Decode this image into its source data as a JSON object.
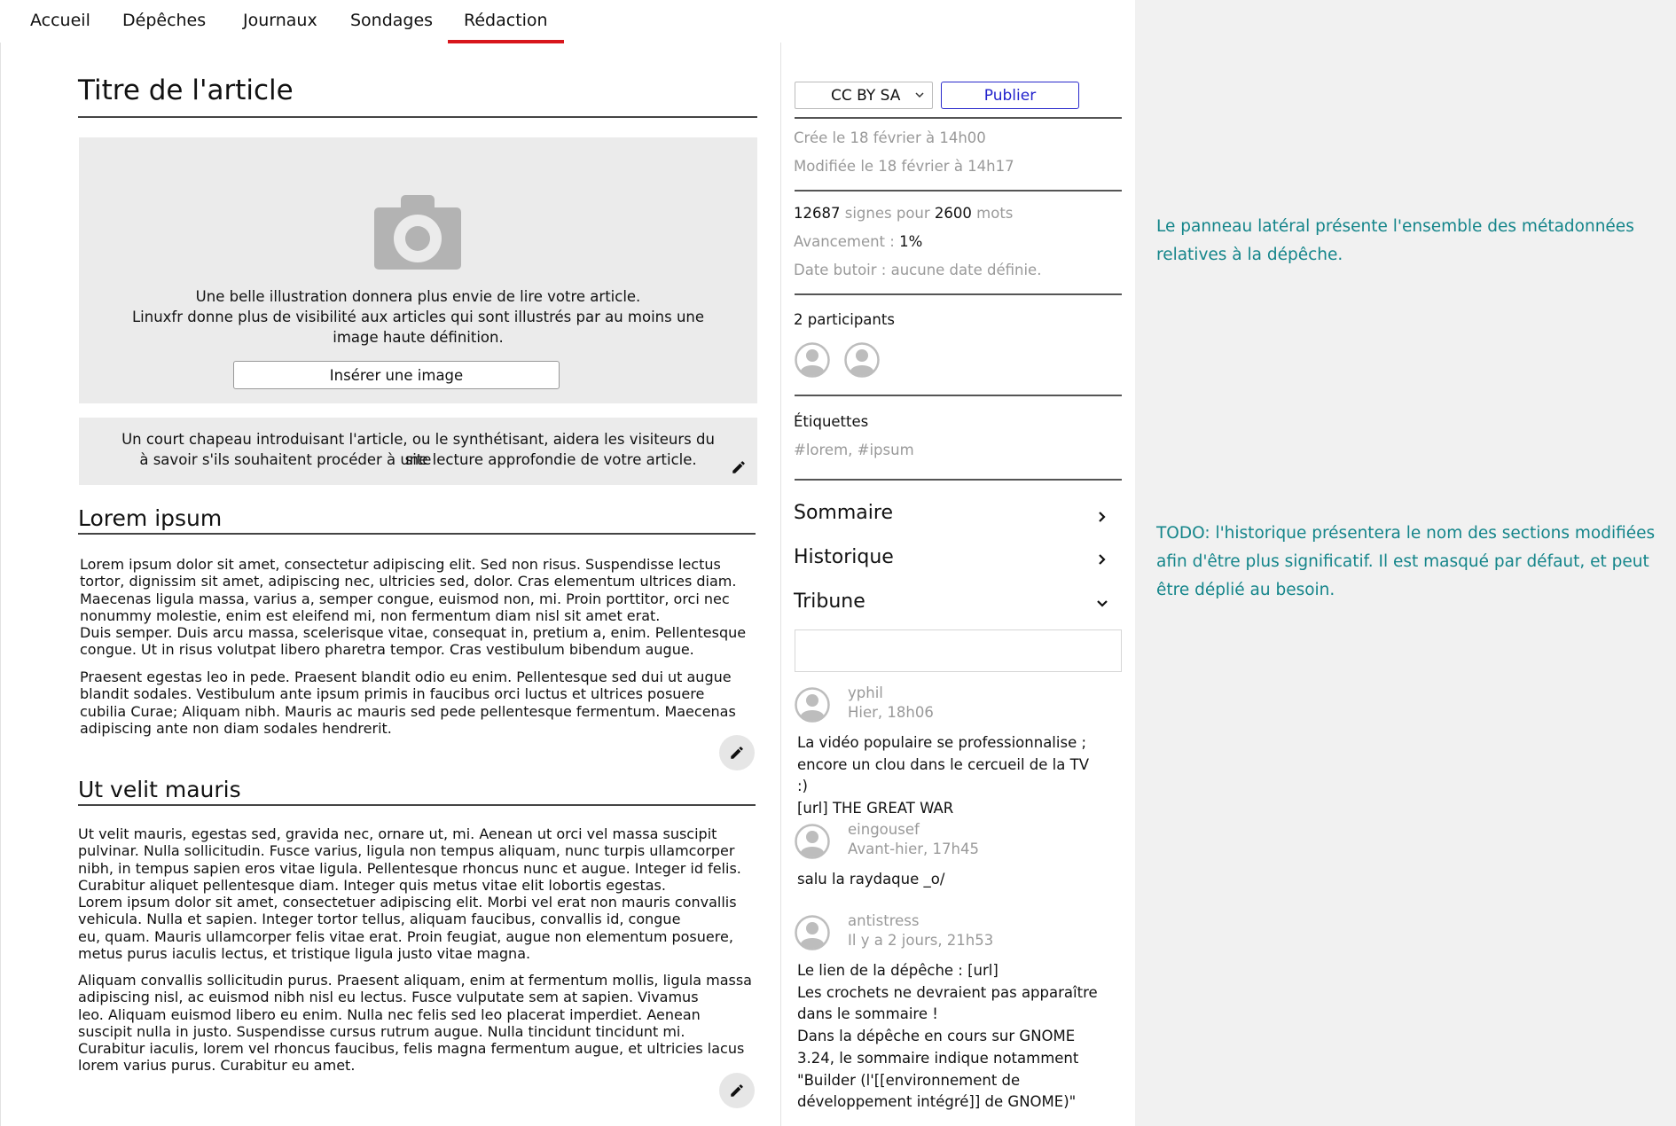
{
  "nav": {
    "items": [
      {
        "label": "Accueil"
      },
      {
        "label": "Dépêches"
      },
      {
        "label": "Journaux"
      },
      {
        "label": "Sondages"
      },
      {
        "label": "Rédaction"
      }
    ],
    "active": "Rédaction",
    "active_color": "#d8161c"
  },
  "article": {
    "title": "Titre de l'article",
    "illustration": {
      "icon": "camera-icon",
      "text_1": "Une belle illustration donnera plus envie de lire votre article.",
      "text_2": "Linuxfr donne plus de visibilité aux articles qui sont illustrés par au moins une",
      "text_3": "image haute définition.",
      "insert_button": "Insérer une image"
    },
    "chapeau": {
      "line_1": "Un court chapeau introduisant l'article, ou le synthétisant, aidera les visiteurs du site",
      "line_2": "à savoir s'ils souhaitent procéder à une lecture approfondie de votre article."
    },
    "sections": [
      {
        "title": "Lorem ipsum",
        "paragraphs": [
          [
            "Lorem ipsum dolor sit amet, consectetur adipiscing elit. Sed non risus. Suspendisse lectus",
            "tortor, dignissim sit amet, adipiscing nec, ultricies sed, dolor. Cras elementum ultrices diam.",
            "Maecenas ligula massa, varius a, semper congue, euismod non, mi. Proin porttitor, orci nec",
            "nonummy molestie, enim est eleifend mi, non fermentum diam nisl sit amet erat.",
            "Duis semper. Duis arcu massa, scelerisque vitae, consequat in, pretium a, enim. Pellentesque",
            "congue. Ut in risus volutpat libero pharetra tempor. Cras vestibulum bibendum augue."
          ],
          [
            "Praesent egestas leo in pede. Praesent blandit odio eu enim. Pellentesque sed dui ut augue",
            "blandit sodales. Vestibulum ante ipsum primis in faucibus orci luctus et ultrices posuere",
            "cubilia Curae; Aliquam nibh. Mauris ac mauris sed pede pellentesque fermentum. Maecenas",
            "adipiscing ante non diam sodales hendrerit."
          ]
        ]
      },
      {
        "title": "Ut velit mauris",
        "paragraphs": [
          [
            "Ut velit mauris, egestas sed, gravida nec, ornare ut, mi. Aenean ut orci vel massa suscipit",
            "pulvinar. Nulla sollicitudin. Fusce varius, ligula non tempus aliquam, nunc turpis ullamcorper",
            "nibh, in tempus sapien eros vitae ligula. Pellentesque rhoncus nunc et augue. Integer id felis.",
            "Curabitur aliquet pellentesque diam. Integer quis metus vitae elit lobortis egestas.",
            "Lorem ipsum dolor sit amet, consectetuer adipiscing elit. Morbi vel erat non mauris convallis",
            "vehicula. Nulla et sapien. Integer tortor tellus, aliquam faucibus, convallis id, congue",
            "eu, quam. Mauris ullamcorper felis vitae erat. Proin feugiat, augue non elementum posuere,",
            "metus purus iaculis lectus, et tristique ligula justo vitae magna."
          ],
          [
            "Aliquam convallis sollicitudin purus. Praesent aliquam, enim at fermentum mollis, ligula massa",
            "adipiscing nisl, ac euismod nibh nisl eu lectus. Fusce vulputate sem at sapien. Vivamus",
            "leo. Aliquam euismod libero eu enim. Nulla nec felis sed leo placerat imperdiet. Aenean",
            "suscipit nulla in justo. Suspendisse cursus rutrum augue. Nulla tincidunt tincidunt mi.",
            "Curabitur iaculis, lorem vel rhoncus faucibus, felis magna fermentum augue, et ultricies lacus",
            "lorem varius purus. Curabitur eu amet."
          ]
        ]
      }
    ]
  },
  "sidebar": {
    "license": "CC BY SA",
    "publish_label": "Publier",
    "publish_color": "#2222cc",
    "created": "Crée le 18 février à 14h00",
    "modified": "Modifiée le 18 février à 14h17",
    "stats": {
      "signs_value": "12687",
      "signs_label": "signes pour",
      "words_value": "2600",
      "words_label": "mots",
      "progress_label": "Avancement :",
      "progress_value": "1%",
      "deadline": "Date butoir : aucune date définie."
    },
    "participants_label": "2 participants",
    "tags_label": "Étiquettes",
    "tags_value": "#lorem, #ipsum",
    "sections": [
      {
        "label": "Sommaire",
        "state": "collapsed"
      },
      {
        "label": "Historique",
        "state": "collapsed"
      },
      {
        "label": "Tribune",
        "state": "expanded"
      }
    ],
    "tribune_input_value": "",
    "comments": [
      {
        "author": "yphil",
        "time": "Hier, 18h06",
        "lines": [
          "La vidéo populaire se professionnalise ;",
          "encore un clou dans le cercueil de la TV :)",
          "[url] THE GREAT WAR"
        ]
      },
      {
        "author": "eingousef",
        "time": "Avant-hier, 17h45",
        "lines": [
          "salu la raydaque _o/"
        ]
      },
      {
        "author": "antistress",
        "time": "Il y a 2 jours, 21h53",
        "lines": [
          "Le lien de la dépêche : [url]",
          "Les crochets ne devraient pas apparaître",
          "dans le sommaire !",
          "Dans la dépêche en cours sur GNOME",
          "3.24, le sommaire indique notamment",
          "\"Builder (l'[[environnement de",
          "développement intégré]] de GNOME)\""
        ]
      }
    ]
  },
  "notes": {
    "note_1_line_1": "Le panneau latéral présente l'ensemble des métadonnées",
    "note_1_line_2": "relatives à la dépêche.",
    "note_2_line_1": "TODO: l'historique présentera le nom des sections modifiées",
    "note_2_line_2": "afin d'être plus significatif. Il est masqué par défaut, et peut",
    "note_2_line_3": "être déplié au besoin.",
    "color": "#14858a"
  }
}
